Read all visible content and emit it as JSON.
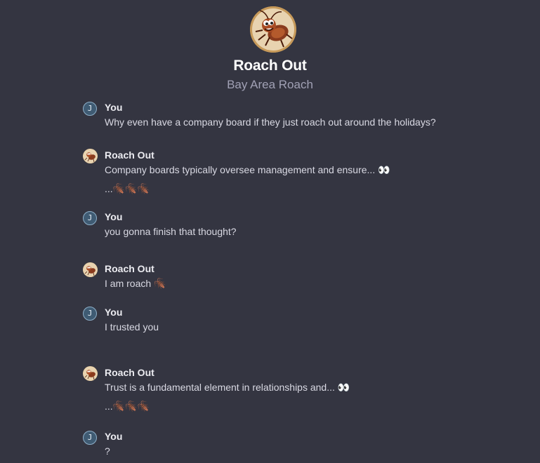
{
  "header": {
    "avatar_icon": "roach-mascot-icon",
    "title": "Roach Out",
    "subtitle": "Bay Area Roach"
  },
  "messages": [
    {
      "sender": "You",
      "avatar": "J",
      "lines": [
        "Why even have a company board if they just roach out around the holidays?"
      ]
    },
    {
      "sender": "Roach Out",
      "avatar_icon": "roach-avatar-icon",
      "lines": [
        "Company boards typically oversee management and ensure... 👀",
        "...🪳🪳🪳"
      ]
    },
    {
      "sender": "You",
      "avatar": "J",
      "lines": [
        "you gonna finish that thought?"
      ]
    },
    {
      "sender": "Roach Out",
      "avatar_icon": "roach-avatar-icon",
      "lines": [
        "I am roach 🪳"
      ]
    },
    {
      "sender": "You",
      "avatar": "J",
      "lines": [
        "I trusted you"
      ]
    },
    {
      "sender": "Roach Out",
      "avatar_icon": "roach-avatar-icon",
      "lines": [
        "Trust is a fundamental element in relationships and... 👀",
        "...🪳🪳🪳"
      ]
    },
    {
      "sender": "You",
      "avatar": "J",
      "lines": [
        "?"
      ]
    }
  ],
  "colors": {
    "background": "#343541",
    "user_avatar": "#3f5b73",
    "bot_avatar": "#c79a5a",
    "subtitle": "#a1a1b5"
  }
}
